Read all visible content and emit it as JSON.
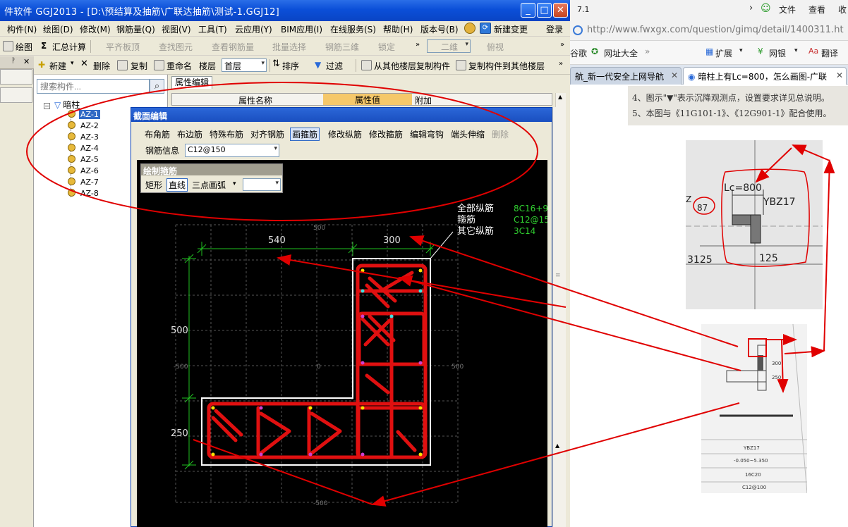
{
  "app": {
    "title": "件软件 GGJ2013 - [D:\\预结算及抽筋\\广联达抽筋\\测试-1.GGJ12]",
    "window_controls": {
      "minimize": "_",
      "maximize": "□",
      "close": "✕"
    }
  },
  "menu": {
    "items": [
      "构件(N)",
      "绘图(D)",
      "修改(M)",
      "钢筋量(Q)",
      "视图(V)",
      "工具(T)",
      "云应用(Y)",
      "BIM应用(I)",
      "在线服务(S)",
      "帮助(H)",
      "版本号(B)"
    ],
    "new_change": "新建变更",
    "login": "登录"
  },
  "toolbar1": {
    "draw": "绘图",
    "sum_calc": "汇总计算",
    "flat_top": "平齐板顶",
    "find_element": "查找图元",
    "view_rebar": "查看钢筋量",
    "batch_select": "批量选择",
    "rebar_3d": "钢筋三维",
    "lock": "锁定",
    "view_mode": "二维",
    "top_view": "俯视"
  },
  "toolbar2": {
    "new": "新建",
    "delete": "删除",
    "copy": "复制",
    "rename": "重命名",
    "floor_label": "楼层",
    "floor_value": "首层",
    "sort": "排序",
    "filter": "过滤",
    "copy_from_floor": "从其他楼层复制构件",
    "copy_to_floor": "复制构件到其他楼层"
  },
  "tree": {
    "search_placeholder": "搜索构件...",
    "root": "暗柱",
    "nodes": [
      "AZ-1",
      "AZ-2",
      "AZ-3",
      "AZ-4",
      "AZ-5",
      "AZ-6",
      "AZ-7",
      "AZ-8"
    ],
    "selected_index": 0
  },
  "properties": {
    "tab": "属性编辑",
    "col_name": "属性名称",
    "col_value": "属性值",
    "col_extra": "附加"
  },
  "section_dialog": {
    "title": "截面编辑",
    "tools": [
      "布角筋",
      "布边筋",
      "特殊布筋",
      "对齐钢筋",
      "画箍筋",
      "修改纵筋",
      "修改箍筋",
      "编辑弯钩",
      "端头伸缩",
      "删除"
    ],
    "active_tool_index": 4,
    "disabled_tool_index": 9,
    "rebar_info_label": "钢筋信息",
    "rebar_info_value": "C12@150",
    "draw_panel": {
      "title": "绘制箍筋",
      "modes": [
        "矩形",
        "直线",
        "三点画弧"
      ],
      "active_mode_index": 1
    },
    "canvas": {
      "label_all_long": "全部纵筋",
      "value_all_long": "8C16+9",
      "label_stirrup": "箍筋",
      "value_stirrup": "C12@15",
      "label_other_long": "其它纵筋",
      "value_other_long": "3C14",
      "dim_540": "540",
      "dim_300": "300",
      "dim_500": "500",
      "dim_250": "250",
      "grid_500_top": "500",
      "grid_0": "0",
      "grid_neg500": "-500",
      "grid_500_right": "500",
      "grid_neg500_bottom": "-500"
    },
    "colors": {
      "stirrup": "#e01010",
      "outline": "#ffffff",
      "dimension": "#20c020",
      "text_value": "#30d030"
    }
  },
  "browser": {
    "corner_text": "7.1",
    "menu_file": "文件",
    "menu_view": "查看",
    "menu_collect": "收",
    "url": "http://www.fwxgx.com/question/gimq/detail/1400311.ht",
    "bm_google": "谷歌",
    "bm_sites": "网址大全",
    "bm_extend": "扩展",
    "bm_bank": "网银",
    "bm_translate": "翻译",
    "tab1": "航_新一代安全上网导航",
    "tab2": "暗柱上有Lc=800，怎么画图-广联",
    "doc_line1": "4、图示\"▼\"表示沉降观测点，设置要求详见总说明。",
    "doc_line2": "5、本图与《11G101-1》、《12G901-1》配合使用。",
    "photo1": {
      "lc": "Lc=800",
      "ybz": "YBZ17",
      "z": "Z",
      "n87": "87",
      "n3125": "3125",
      "n125": "125"
    },
    "photo2": {
      "ybz": "YBZ17",
      "elev": "-0.050~5.350",
      "rebar": "16C20",
      "stirrup": "C12@100",
      "d300": "300",
      "d250": "250"
    }
  }
}
